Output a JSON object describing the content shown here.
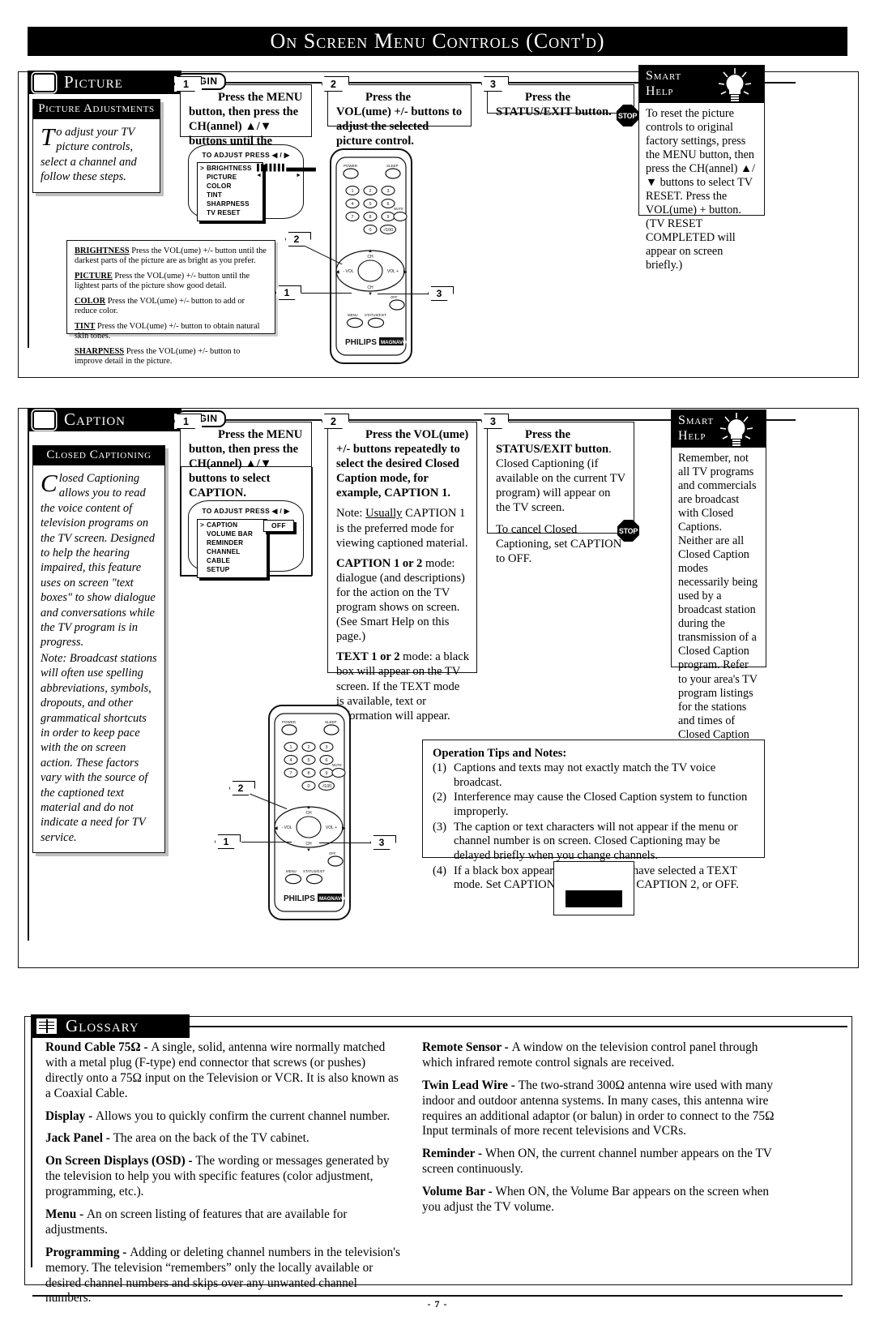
{
  "page": {
    "title": "On Screen Menu Controls (Cont'd)",
    "page_number": "- 7 -"
  },
  "picture_section": {
    "heading": "Picture",
    "tv_icon": "tv-icon",
    "begin_label": "BEGIN",
    "stop_label": "STOP",
    "intro": {
      "heading": "Picture Adjustments",
      "dropcap": "T",
      "text": "o adjust your TV picture controls, select a channel and follow these steps."
    },
    "steps": [
      {
        "number": "1",
        "bold": "Press the MENU button, then press the CH(annel) ▲/▼ buttons until the desired control shows on screen.",
        "rest": ""
      },
      {
        "number": "2",
        "bold": "Press the VOL(ume) +/- buttons to adjust the selected picture control.",
        "rest": ""
      },
      {
        "number": "3",
        "bold": "Press the STATUS/EXIT button.",
        "rest": ""
      }
    ],
    "osd": {
      "prompt": "TO ADJUST PRESS ◀ / ▶",
      "cursor": ">",
      "items": [
        "BRIGHTNESS",
        "PICTURE",
        "COLOR",
        "TINT",
        "SHARPNESS",
        "TV RESET"
      ],
      "bar_filled": "▌▌▌▌▌▌▌",
      "bar_empty": "▄▄▄▄▄▄▄"
    },
    "adjustments": [
      {
        "term": "BRIGHTNESS",
        "desc": "Press the VOL(ume) +/- button until the darkest parts of the picture are as bright as you prefer."
      },
      {
        "term": "PICTURE",
        "desc": "Press  the VOL(ume) +/- button until the lightest parts of the picture show good detail."
      },
      {
        "term": "COLOR",
        "desc": "Press the VOL(ume) +/- button to add or reduce color."
      },
      {
        "term": "TINT",
        "desc": "Press the VOL(ume) +/- button to obtain natural skin tones."
      },
      {
        "term": "SHARPNESS",
        "desc": "Press the VOL(ume) +/- button to improve detail in the picture."
      }
    ],
    "smart_help": {
      "line1": "Smart",
      "line2": "Help",
      "icon": "lightbulb-icon",
      "body": "To reset the picture controls to original factory settings, press the MENU button, then press the CH(annel) ▲/▼ buttons to select TV RESET. Press the VOL(ume) + button. (TV RESET COMPLETED will appear on screen briefly.)"
    },
    "callouts": [
      "1",
      "2",
      "3"
    ]
  },
  "caption_section": {
    "heading": "Caption",
    "tv_icon": "tv-icon",
    "begin_label": "BEGIN",
    "stop_label": "STOP",
    "intro": {
      "heading": "Closed Captioning",
      "dropcap": "C",
      "text": "losed Captioning allows you to read the voice content of television programs on the TV screen. Designed to help the hearing impaired, this feature uses on screen \"text boxes\" to show dialogue and conversations while the TV program is in progress.",
      "note": "Note: Broadcast stations will often use spelling abbreviations, symbols, dropouts, and other grammatical shortcuts in order to keep pace with the on screen action. These factors vary with the source of the captioned text material and do not indicate a need for TV service."
    },
    "steps": [
      {
        "number": "1",
        "bold": "Press the MENU button, then press the CH(annel) ▲/▼ buttons to select CAPTION.",
        "rest": ""
      },
      {
        "number": "2",
        "bold": "Press the VOL(ume) +/- buttons repeatedly to select the desired Closed Caption mode, for example, CAPTION 1.",
        "p1_prefix": "Note: ",
        "p1_underline": "Usually",
        "p1_rest": " CAPTION 1 is the preferred mode for viewing captioned material.",
        "p2_bold": "CAPTION 1 or 2",
        "p2_rest": " mode: dialogue (and descriptions) for the action on the TV program shows on screen. (See Smart Help on this page.)",
        "p3_bold": "TEXT 1 or 2",
        "p3_rest": " mode: a black box will appear on the TV screen. If the TEXT mode is available, text or information will appear."
      },
      {
        "number": "3",
        "bold": "Press the STATUS/EXIT button",
        "rest": ". Closed Captioning (if available on the current TV program) will appear on the TV screen.",
        "p2": "To cancel Closed Captioning, set CAPTION to OFF."
      }
    ],
    "osd": {
      "prompt": "TO ADJUST PRESS ◀ / ▶",
      "cursor": ">",
      "items": [
        "CAPTION",
        "VOLUME BAR",
        "REMINDER",
        "CHANNEL",
        "CABLE",
        "SETUP"
      ],
      "value": "OFF"
    },
    "smart_help": {
      "line1": "Smart",
      "line2": "Help",
      "icon": "lightbulb-icon",
      "body": "Remember, not all TV programs and commercials are broadcast with Closed Captions. Neither are all Closed Caption modes necessarily being used by a broadcast station during the transmission of a Closed Caption program. Refer to your area's TV program listings for the stations and times of Closed Caption shows."
    },
    "tips": {
      "heading": "Operation Tips and Notes:",
      "items": [
        {
          "n": "(1)",
          "text": "Captions and texts may not exactly match the TV voice broadcast."
        },
        {
          "n": "(2)",
          "text": "Interference may cause the Closed Caption system to function improperly."
        },
        {
          "n": "(3)",
          "text": "The caption or text characters will not appear if the menu or channel number is on screen. Closed Captioning may be delayed briefly when you change channels."
        },
        {
          "n": "(4)",
          "text": "If a black box appears on screen, you have selected a TEXT mode. Set CAPTION to CAPTION 1, CAPTION 2, or OFF."
        }
      ]
    },
    "callouts": [
      "1",
      "2",
      "3"
    ]
  },
  "remote": {
    "brand": "PHILIPS",
    "sub_brand": "MAGNAVOX",
    "buttons": {
      "power": "POWER",
      "sleep": "SLEEP",
      "mute": "MUTE",
      "menu": "MENU",
      "status_exit": "STATUS/EXIT",
      "ch": "CH",
      "vol_minus": "- VOL",
      "vol_plus": "VOL +",
      "dash_100": "-/100",
      "zero": "0",
      "keys": [
        "1",
        "2",
        "3",
        "4",
        "5",
        "6",
        "7",
        "8",
        "9"
      ]
    }
  },
  "glossary": {
    "heading": "Glossary",
    "icon": "book-icon",
    "left_column": [
      {
        "term": "Round Cable 75Ω - ",
        "def": "A single, solid, antenna wire normally matched with a metal plug (F-type) end connector that screws (or pushes) directly onto a 75Ω input on the Television or VCR. It is also known as a Coaxial Cable."
      },
      {
        "term": "Display - ",
        "def": "Allows you to quickly confirm the current channel number."
      },
      {
        "term": "Jack Panel - ",
        "def": "The area on the back of the TV cabinet."
      },
      {
        "term": "On Screen Displays (OSD) - ",
        "def": "The wording or messages generated by the television to help you with specific features (color adjustment, programming, etc.)."
      },
      {
        "term": "Menu - ",
        "def": "An on screen listing of features that are available for adjustments."
      },
      {
        "term": "Programming - ",
        "def": "Adding or deleting channel numbers in the television's memory. The television “remembers” only the locally available or desired channel numbers and skips over any unwanted channel numbers."
      }
    ],
    "right_column": [
      {
        "term": "Remote Sensor - ",
        "def": "A window on the television control panel through which infrared remote control signals are received."
      },
      {
        "term": "Twin Lead Wire - ",
        "def": "The two-strand 300Ω antenna wire used with many indoor and outdoor antenna systems. In many cases, this antenna wire requires an additional adaptor (or balun) in order to connect to the 75Ω Input terminals of more recent televisions and VCRs."
      },
      {
        "term": "Reminder - ",
        "def": "When ON, the current channel number appears on the TV screen continuously."
      },
      {
        "term": "Volume Bar - ",
        "def": "When ON, the Volume Bar appears on the screen when you adjust the TV volume."
      }
    ]
  }
}
